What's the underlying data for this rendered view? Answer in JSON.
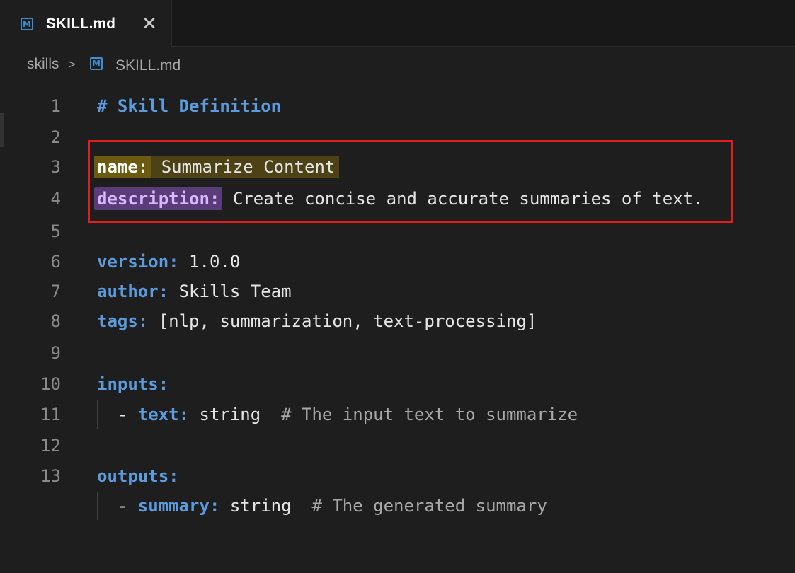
{
  "tab": {
    "title": "SKILL.md",
    "icon": "markdown-icon",
    "icon_glyph": "M",
    "close_glyph": "✕"
  },
  "breadcrumb": {
    "folder": "skills",
    "separator": ">",
    "file": "SKILL.md"
  },
  "lines": [
    {
      "number": "1",
      "heading": "# Skill Definition"
    },
    {
      "number": "2"
    },
    {
      "number": "3",
      "key": "name:",
      "value": " Summarize Content"
    },
    {
      "number": "4",
      "key": "description:",
      "value": " Create concise and accurate summaries of text."
    },
    {
      "number": "5"
    },
    {
      "number": "6",
      "key": "version:",
      "value": " 1.0.0"
    },
    {
      "number": "7",
      "key": "author:",
      "value": " Skills Team"
    },
    {
      "number": "8",
      "key": "tags:",
      "value": " [nlp, summarization, text-processing]"
    },
    {
      "number": "9"
    },
    {
      "number": "10",
      "key": "inputs:"
    },
    {
      "number": "11",
      "prefix": "  - ",
      "key": "text:",
      "value": " string  ",
      "comment": "# The input text to summarize"
    },
    {
      "number": "12"
    },
    {
      "number": "13",
      "key": "outputs:"
    },
    {
      "prefix": "  - ",
      "key": "summary:",
      "value": " string  ",
      "comment": "# The generated summary"
    }
  ],
  "colors": {
    "highlight_box": "#e01e1e",
    "key": "#5c9cde",
    "name_highlight": "#6b5a10",
    "description_highlight": "#5a3c78"
  }
}
